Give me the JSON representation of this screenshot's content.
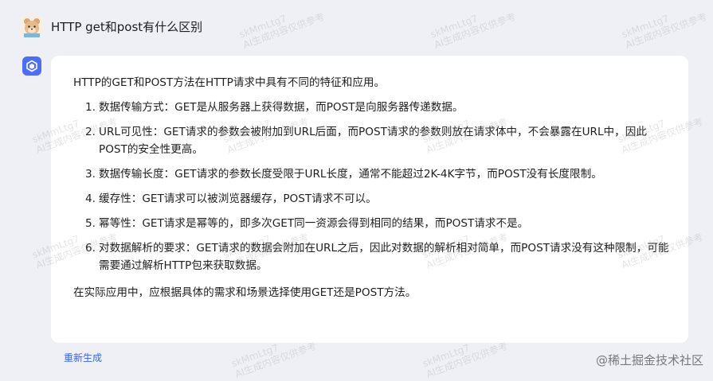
{
  "user": {
    "question": "HTTP get和post有什么区别"
  },
  "answer": {
    "intro": "HTTP的GET和POST方法在HTTP请求中具有不同的特征和应用。",
    "points": [
      {
        "num": "1.",
        "text": "数据传输方式：GET是从服务器上获得数据，而POST是向服务器传递数据。"
      },
      {
        "num": "2.",
        "text": "URL可见性：GET请求的参数会被附加到URL后面，而POST请求的参数则放在请求体中，不会暴露在URL中，因此POST的安全性更高。"
      },
      {
        "num": "3.",
        "text": "数据传输长度：GET请求的参数长度受限于URL长度，通常不能超过2K-4K字节，而POST没有长度限制。"
      },
      {
        "num": "4.",
        "text": "缓存性：GET请求可以被浏览器缓存，POST请求不可以。"
      },
      {
        "num": "5.",
        "text": "幂等性：GET请求是幂等的，即多次GET同一资源会得到相同的结果，而POST请求不是。"
      },
      {
        "num": "6.",
        "text": "对数据解析的要求：GET请求的数据会附加在URL之后，因此对数据的解析相对简单，而POST请求没有这种限制，可能需要通过解析HTTP包来获取数据。"
      }
    ],
    "conclusion": "在实际应用中，应根据具体的需求和场景选择使用GET还是POST方法。"
  },
  "actions": {
    "regenerate": "重新生成"
  },
  "watermark": {
    "line1": "skMmLtg7",
    "line2": "AI生成内容仅供参考",
    "footer": "@稀土掘金技术社区"
  },
  "colors": {
    "page_background": "#eef0f6",
    "card_background": "#ffffff",
    "accent": "#4e6ef2",
    "link": "#3b64e4"
  },
  "icons": {
    "user_avatar": "cartoon-animal-avatar-icon",
    "bot_avatar": "cube-logo-icon"
  }
}
